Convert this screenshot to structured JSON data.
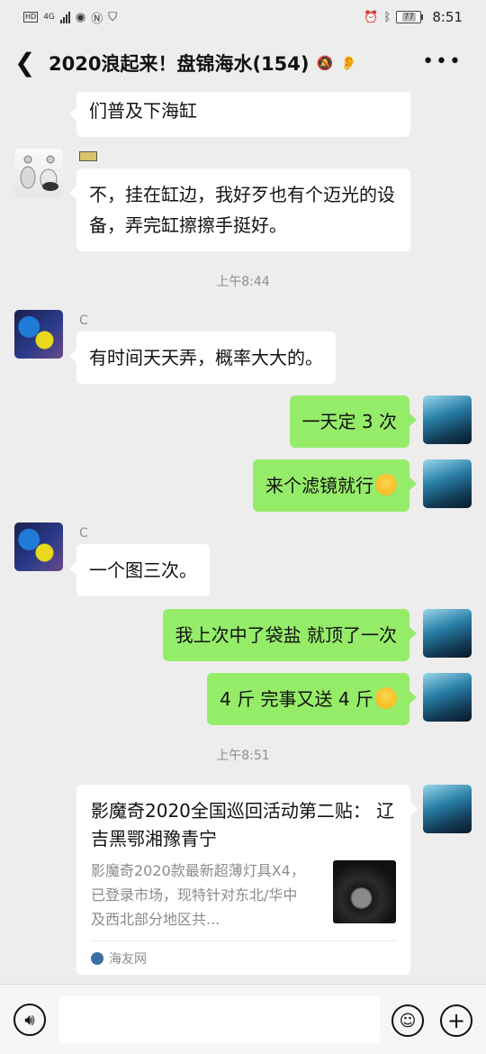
{
  "status_bar": {
    "time": "8:51",
    "battery": "77",
    "net": "4G"
  },
  "header": {
    "title": "2020浪起来！盘锦海水(154)",
    "back_icon": "chevron-left-icon",
    "more_icon": "more-icon"
  },
  "messages": [
    {
      "type": "in",
      "text": "们普及下海缸"
    },
    {
      "type": "in",
      "sender": "",
      "text": "不，挂在缸边，我好歹也有个迈光的设备，弄完缸擦擦手挺好。"
    },
    {
      "type": "time",
      "text": "上午8:44"
    },
    {
      "type": "in",
      "sender": "C",
      "text": "有时间天天弄，概率大大的。"
    },
    {
      "type": "out",
      "text": "一天定 3 次"
    },
    {
      "type": "out",
      "text": "来个滤镜就行"
    },
    {
      "type": "in",
      "sender": "C",
      "text": "一个图三次。"
    },
    {
      "type": "out",
      "text": "我上次中了袋盐 就顶了一次"
    },
    {
      "type": "out",
      "text": "4 斤  完事又送 4 斤"
    },
    {
      "type": "time",
      "text": "上午8:51"
    }
  ],
  "link_card": {
    "title": "影魔奇2020全国巡回活动第二贴：  辽吉黑鄂湘豫青宁",
    "description": "影魔奇2020款最新超薄灯具X4，已登录市场，现特针对东北/华中及西北部分地区共...",
    "source": "海友网"
  },
  "input_bar": {
    "voice_icon": "voice-icon",
    "emoji_icon": "emoji-icon",
    "plus_icon": "plus-icon"
  }
}
